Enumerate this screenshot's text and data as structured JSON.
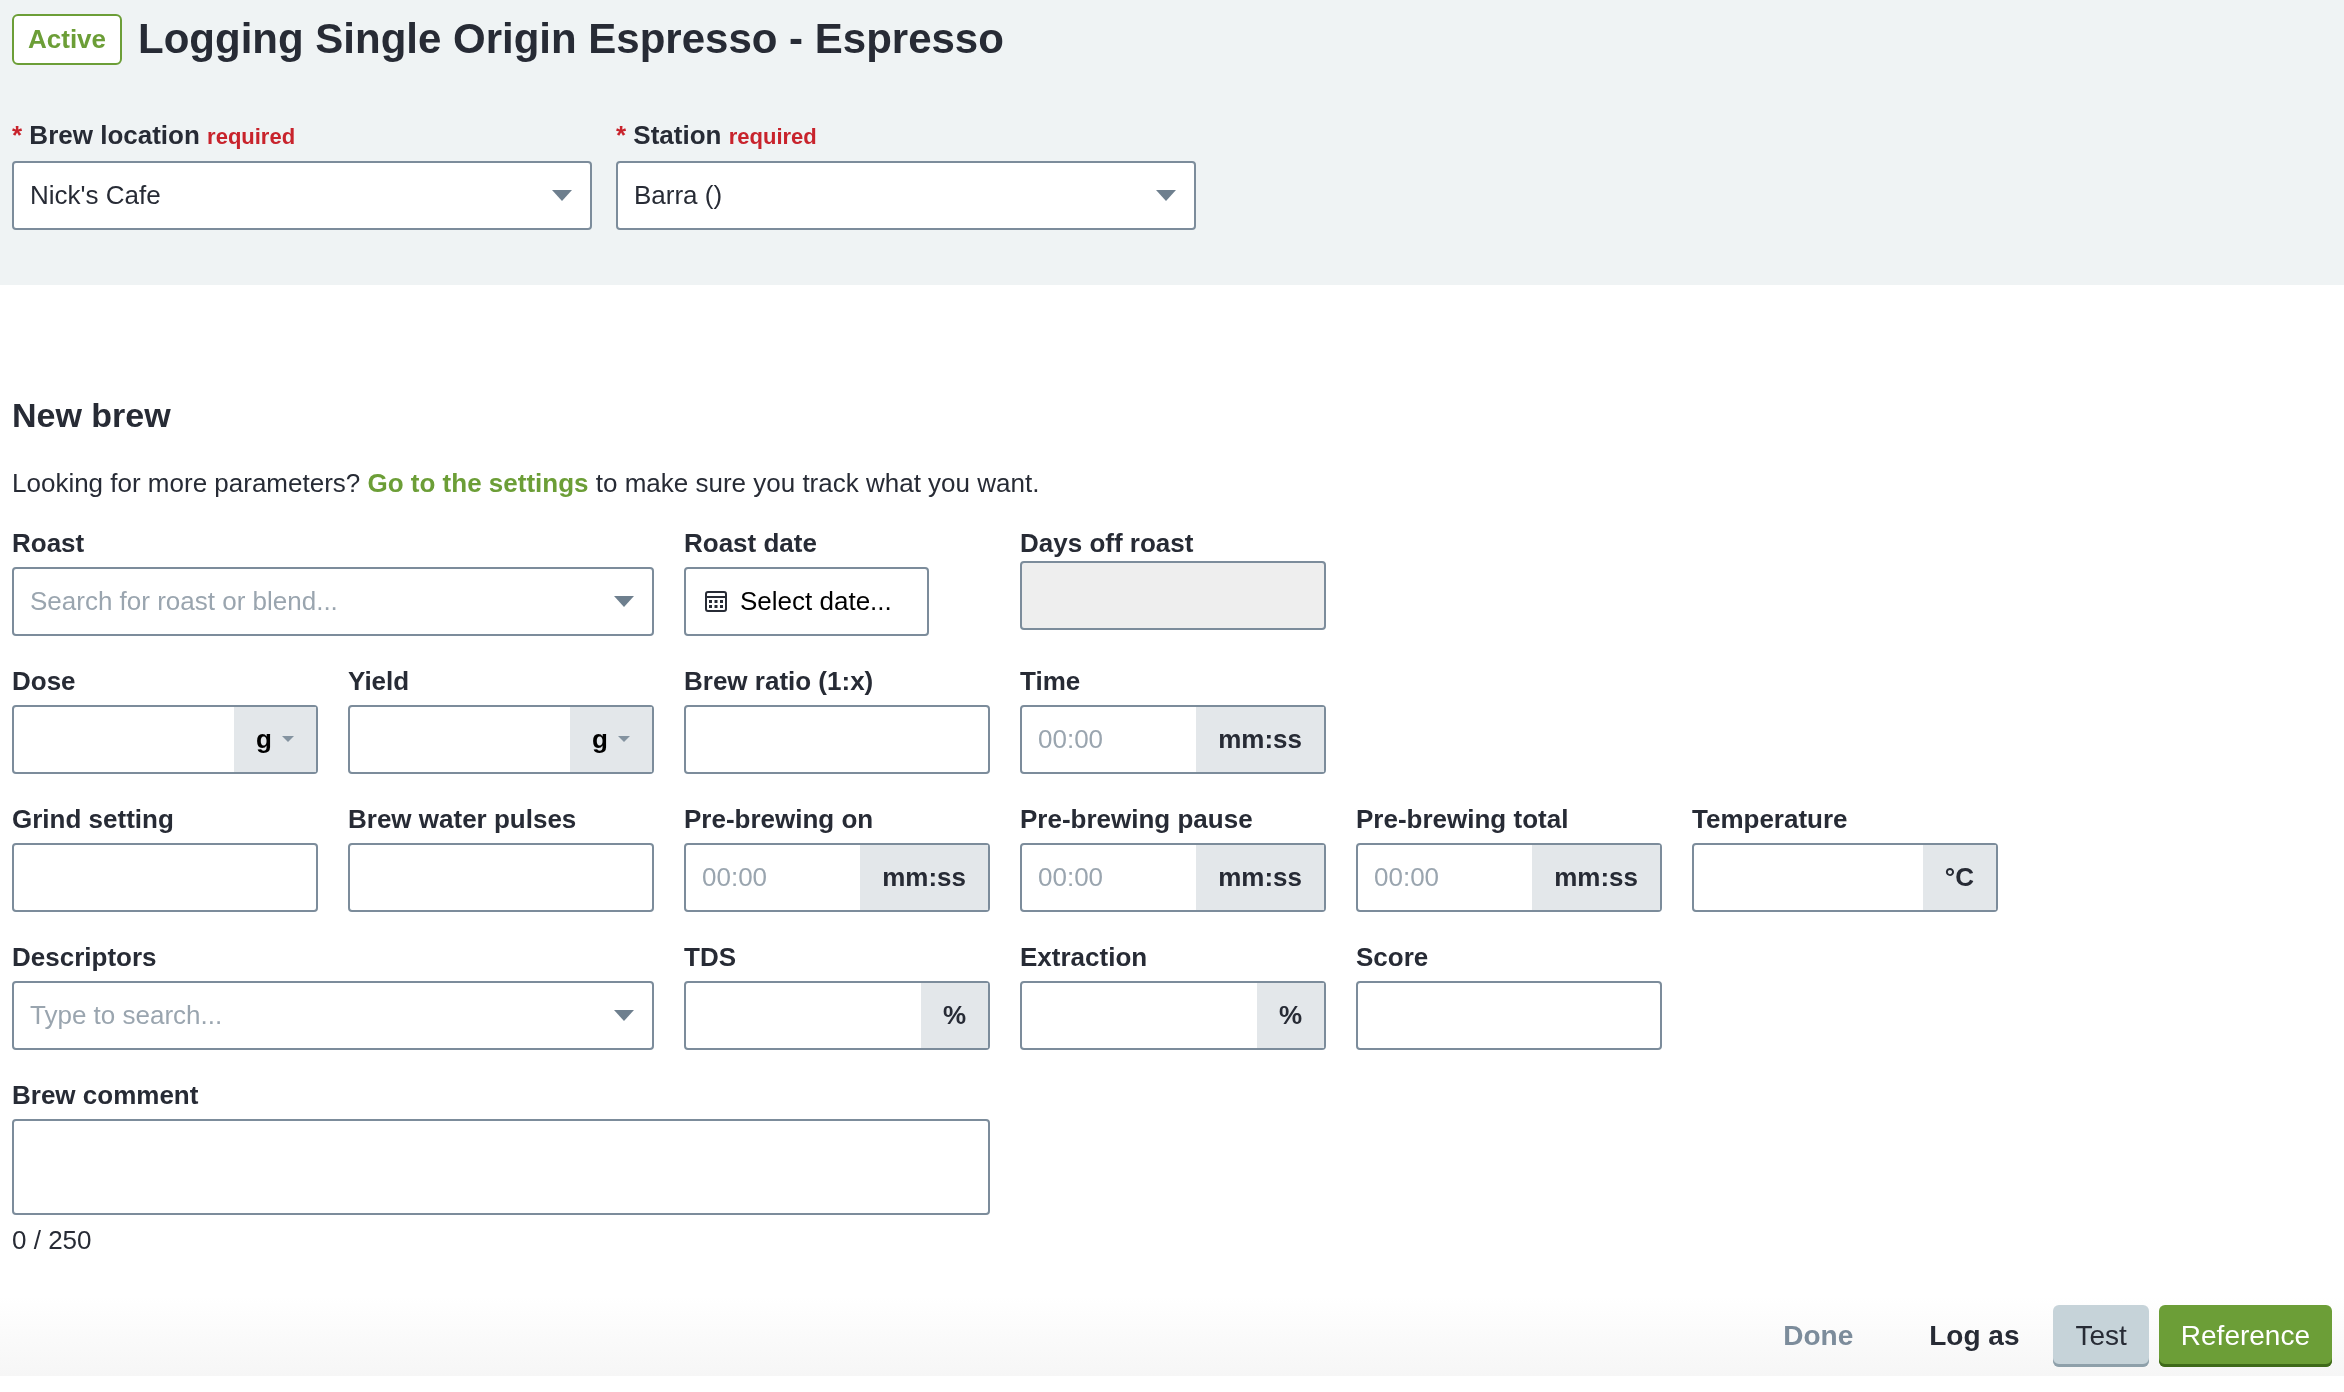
{
  "header": {
    "status_badge": "Active",
    "title": "Logging Single Origin Espresso - Espresso",
    "fields": [
      {
        "label": "Brew location",
        "required_mark": "*",
        "required_text": "required",
        "value": "Nick's Cafe"
      },
      {
        "label": "Station",
        "required_mark": "*",
        "required_text": "required",
        "value": "Barra ()"
      }
    ]
  },
  "section_title": "New brew",
  "hint": {
    "before": "Looking for more parameters?",
    "link": "Go to the settings",
    "after": "to make sure you track what you want."
  },
  "rows": [
    [
      {
        "kind": "select",
        "label": "Roast",
        "placeholder": "Search for roast or blend..."
      },
      {
        "kind": "date",
        "label": "Roast date",
        "value": "Select date..."
      },
      {
        "kind": "disabled",
        "label": "Days off roast"
      }
    ],
    [
      {
        "kind": "unitselect",
        "label": "Dose",
        "unit": "g"
      },
      {
        "kind": "unitselect",
        "label": "Yield",
        "unit": "g"
      },
      {
        "kind": "text",
        "label": "Brew ratio (1:x)"
      },
      {
        "kind": "addon",
        "label": "Time",
        "placeholder": "00:00",
        "unit": "mm:ss"
      }
    ],
    [
      {
        "kind": "text",
        "label": "Grind setting"
      },
      {
        "kind": "text",
        "label": "Brew water pulses"
      },
      {
        "kind": "addon",
        "label": "Pre-brewing on",
        "placeholder": "00:00",
        "unit": "mm:ss"
      },
      {
        "kind": "addon",
        "label": "Pre-brewing pause",
        "placeholder": "00:00",
        "unit": "mm:ss"
      },
      {
        "kind": "addon",
        "label": "Pre-brewing total",
        "placeholder": "00:00",
        "unit": "mm:ss"
      },
      {
        "kind": "addon",
        "label": "Temperature",
        "unit": "°C"
      }
    ],
    [
      {
        "kind": "select",
        "label": "Descriptors",
        "placeholder": "Type to search..."
      },
      {
        "kind": "addon",
        "label": "TDS",
        "unit": "%"
      },
      {
        "kind": "addon",
        "label": "Extraction",
        "unit": "%"
      },
      {
        "kind": "text",
        "label": "Score"
      }
    ],
    [
      {
        "kind": "textarea",
        "label": "Brew comment",
        "counter": "0 / 250"
      }
    ]
  ],
  "footer": {
    "done": "Done",
    "log_as": "Log as",
    "buttons": [
      {
        "kind": "secondary",
        "label": "Test"
      },
      {
        "kind": "primary",
        "label": "Reference"
      }
    ]
  }
}
